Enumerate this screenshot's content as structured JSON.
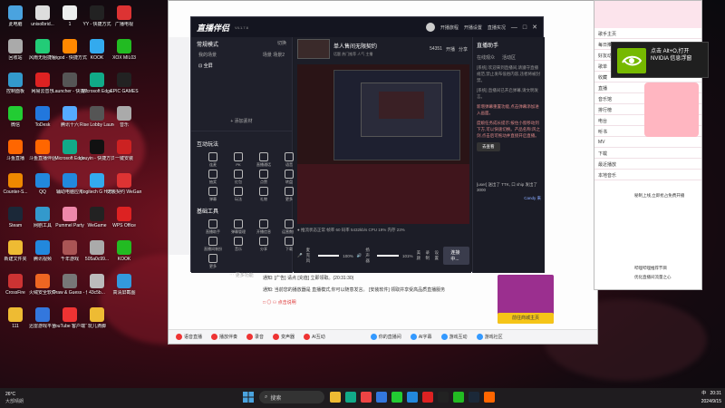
{
  "desktop": {
    "icons": [
      {
        "label": "此电脑",
        "color": "#4aa3df"
      },
      {
        "label": "unisolbrid...",
        "color": "#ddd"
      },
      {
        "label": "1",
        "color": "#eee"
      },
      {
        "label": "YY - 快捷方式",
        "color": "#222"
      },
      {
        "label": "广播电视",
        "color": "#d33"
      },
      {
        "label": "回收站",
        "color": "#aaa"
      },
      {
        "label": "风雨无阻捷径",
        "color": "#2c7"
      },
      {
        "label": "leigod - 快捷方式",
        "color": "#f80"
      },
      {
        "label": "KOOK",
        "color": "#3ae"
      },
      {
        "label": "XOX MIL03",
        "color": "#2b2"
      },
      {
        "label": "控制面板",
        "color": "#39c"
      },
      {
        "label": "网易云音乐",
        "color": "#d22"
      },
      {
        "label": "Launcher - 快捷方式",
        "color": "#555"
      },
      {
        "label": "Microsoft Edge",
        "color": "#1a8"
      },
      {
        "label": "EPIC GAMES",
        "color": "#222"
      },
      {
        "label": "微信",
        "color": "#2c3"
      },
      {
        "label": "ToDesk",
        "color": "#27d"
      },
      {
        "label": "腾讯十六",
        "color": "#5af"
      },
      {
        "label": "Rise Lobby Launcher",
        "color": "#555"
      },
      {
        "label": "音乐",
        "color": "#aaa"
      },
      {
        "label": "斗鱼直播",
        "color": "#f60"
      },
      {
        "label": "斗鱼直播伴侣",
        "color": "#f60"
      },
      {
        "label": "Microsoft Edge",
        "color": "#1a8"
      },
      {
        "label": "douyin - 快捷方式",
        "color": "#111"
      },
      {
        "label": "一键安装",
        "color": "#c22"
      },
      {
        "label": "Counter-S...",
        "color": "#e80"
      },
      {
        "label": "QQ",
        "color": "#28d"
      },
      {
        "label": "辅助电脑应用",
        "color": "#28d"
      },
      {
        "label": "Logitech G HUB",
        "color": "#3ae"
      },
      {
        "label": "无畏契约 WeGame版",
        "color": "#d33"
      },
      {
        "label": "Steam",
        "color": "#1b2838"
      },
      {
        "label": "网剧工具",
        "color": "#39c"
      },
      {
        "label": "Pummel Party",
        "color": "#e8a"
      },
      {
        "label": "WeGame",
        "color": "#222"
      },
      {
        "label": "WPS Office",
        "color": "#d22"
      },
      {
        "label": "新建文件夹",
        "color": "#eb3"
      },
      {
        "label": "腾讯视频",
        "color": "#28d"
      },
      {
        "label": "千年游戏",
        "color": "#a55"
      },
      {
        "label": "505a0c99...",
        "color": "#aaa"
      },
      {
        "label": "KOOK",
        "color": "#2b2"
      },
      {
        "label": "CrossFire",
        "color": "#c33"
      },
      {
        "label": "火绒安全软件",
        "color": "#e62"
      },
      {
        "label": "Draw & Guess - 你...",
        "color": "#777"
      },
      {
        "label": "43c5b...",
        "color": "#bbb"
      },
      {
        "label": "高清屏截图",
        "color": "#39d"
      },
      {
        "label": "111",
        "color": "#eb3"
      },
      {
        "label": "迅雷游戏平台",
        "color": "#37d"
      },
      {
        "label": "YouTube 客户端下载",
        "color": "#e33"
      },
      {
        "label": "玩儿滴脚",
        "color": "#eb3"
      }
    ]
  },
  "yy_window": {
    "tabs": [
      "首页",
      "直播",
      "视频",
      "关注"
    ],
    "bottom_items": [
      "语音直播",
      "播放伴奏",
      "录音",
      "变声器",
      "AI互动"
    ],
    "chat_lines": [
      "通知: [广告] 请点 [充值] 立即领取。(20:31:30)",
      "通知: 当前您的播放器是 直播模式,你可以随意发言。 [安装软件] 领取并享受高品质直播服务",
      "□ ◎ ⚇ 点击说明"
    ],
    "game_button": "前往商城主页",
    "bottom_right": [
      "你的直播间",
      "AI字幕",
      "游戏互动",
      "游戏社区"
    ]
  },
  "kuwo_window": {
    "title": "酷狗",
    "list": [
      "歌手主页",
      "每日推荐",
      "好友动态",
      "歌单",
      "收藏",
      "直播",
      "音乐馆",
      "排行榜",
      "电台",
      "听书",
      "MV",
      "下载",
      "最近播放",
      "本地音乐"
    ],
    "chat": [
      "秘制上线,立即抢占免费开播",
      "哔哩哔哩推荐节目",
      "优化直播间流量之心"
    ]
  },
  "notification": {
    "line1": "点击 Alt+O,打开 NVIDIA 信息浮窗",
    "app": "NVIDIA"
  },
  "assistant": {
    "app_name": "直播伴侣",
    "version": "V4.1.7.6",
    "title_right": [
      "开播旅程",
      "开播设置",
      "直播实况"
    ],
    "stream_title": "单人售间无限契约",
    "stream_sub": "话题 热门推荐 人气 主播",
    "viewer_count": "54351",
    "header_buttons": [
      "开播",
      "分享"
    ],
    "sidebar": {
      "mode_label": "常规模式",
      "switch_label": "切换",
      "scene_label": "我的场景",
      "scene_tabs": [
        "场景",
        "场景2"
      ],
      "scene_item": "全屏",
      "add_source": "添加素材",
      "interaction_title": "互动玩法",
      "interaction_tools": [
        "连麦",
        "PK",
        "直播通话",
        "语音",
        "抽奖",
        "红包",
        "点赞",
        "转盘",
        "弹幕",
        "玩法",
        "礼物",
        "更多"
      ],
      "basic_title": "基础工具",
      "basic_tools": [
        "直播助手",
        "弹幕管理",
        "开播信息",
        "运营数据",
        "直播间装扮",
        "音乐",
        "分享",
        "下载",
        "更多"
      ],
      "more_label": "更多功能"
    },
    "preview_tabs": [
      "场景1",
      "场景2"
    ],
    "controls": {
      "mic_label": "麦克风",
      "mic_value": "100%",
      "speaker_label": "扬声器",
      "speaker_value": "101%",
      "beauty_label": "美颜",
      "record_label": "录制",
      "settings_label": "设置",
      "start_button": "连接中..."
    },
    "status_line": "● 推流状态正常 帧率 60  码率 5432kb/s  CPU 19%  内存 23%",
    "right_panel": {
      "title": "直播助手",
      "tabs": [
        "在线观众",
        "活动区"
      ],
      "messages": [
        "[系统] 欢迎来到直播间,请遵守直播规范,禁止发布低俗内容,违者将被封禁。",
        "[系统] 直播间已开启弹幕,请文明发言。",
        "新增弹幕重置功能,点击弹幕添加进入画面。",
        "度娘任务成长提示:按住小窗移动到下方,可以快速切换。产品名称:风之剑,点击后可拖动并直接开启直播。"
      ],
      "see_button": "去查看",
      "user_line": "[user] 送出了 TTK, 口 ship 发出了 3000",
      "candy_user": "Candy 来"
    }
  },
  "taskbar": {
    "weather": "26°C",
    "weather_sub": "大部晴朗",
    "search_placeholder": "搜索",
    "time": "20:31",
    "date": "2024/9/15",
    "lang": "中",
    "apps": [
      "file-explorer",
      "edge",
      "chrome",
      "store",
      "wechat",
      "qq",
      "music",
      "yy",
      "kook",
      "steam",
      "live"
    ]
  }
}
